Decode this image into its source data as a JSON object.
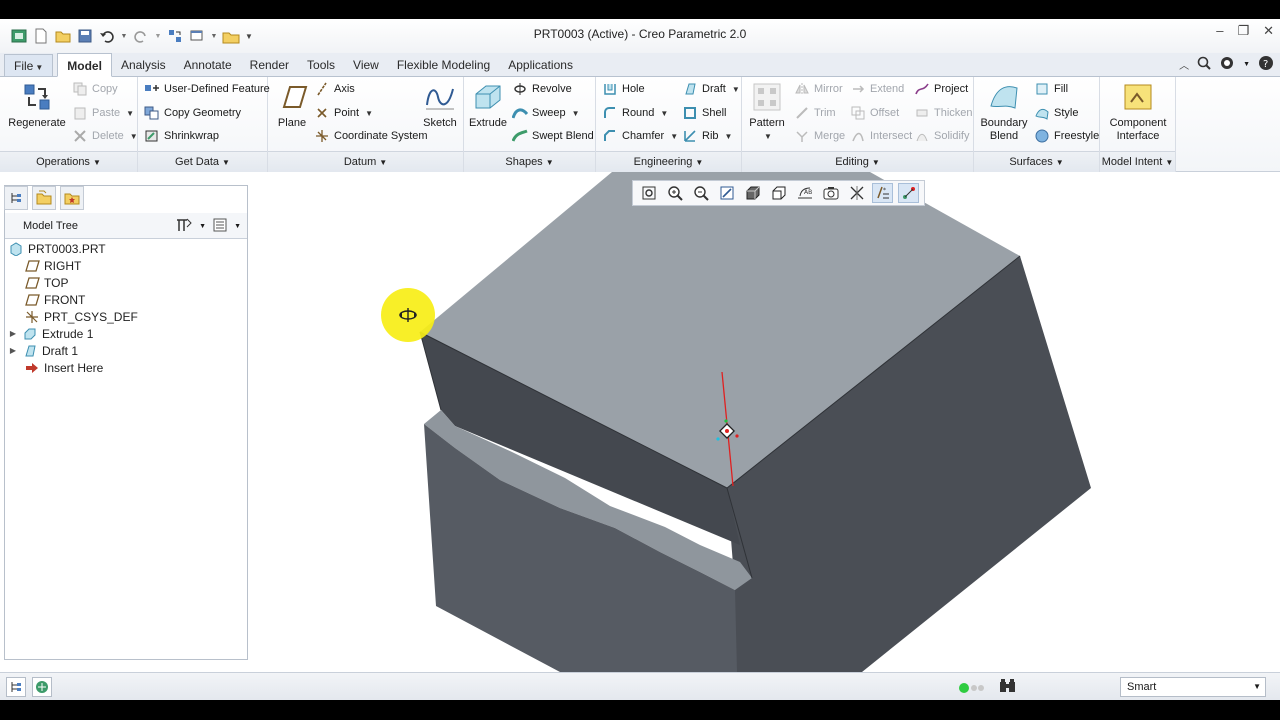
{
  "window": {
    "title": "PRT0003 (Active) - Creo Parametric 2.0",
    "controls": [
      "–",
      "❐",
      "✕"
    ]
  },
  "tabs": [
    "File",
    "Model",
    "Analysis",
    "Annotate",
    "Render",
    "Tools",
    "View",
    "Flexible Modeling",
    "Applications"
  ],
  "active_tab": "Model",
  "ribbon": {
    "operations": {
      "label": "Operations",
      "regenerate": "Regenerate",
      "copy": "Copy",
      "paste": "Paste",
      "delete": "Delete"
    },
    "get_data": {
      "label": "Get Data",
      "udf": "User-Defined Feature",
      "copy_geometry": "Copy Geometry",
      "shrinkwrap": "Shrinkwrap"
    },
    "datum": {
      "label": "Datum",
      "plane": "Plane",
      "axis": "Axis",
      "point": "Point",
      "csys": "Coordinate System",
      "sketch": "Sketch"
    },
    "shapes": {
      "label": "Shapes",
      "extrude": "Extrude",
      "revolve": "Revolve",
      "sweep": "Sweep",
      "swept_blend": "Swept Blend"
    },
    "engineering": {
      "label": "Engineering",
      "hole": "Hole",
      "round": "Round",
      "chamfer": "Chamfer",
      "draft": "Draft",
      "shell": "Shell",
      "rib": "Rib"
    },
    "editing": {
      "label": "Editing",
      "pattern": "Pattern",
      "mirror": "Mirror",
      "trim": "Trim",
      "merge": "Merge",
      "extend": "Extend",
      "offset": "Offset",
      "intersect": "Intersect",
      "project": "Project",
      "thicken": "Thicken",
      "solidify": "Solidify"
    },
    "surfaces": {
      "label": "Surfaces",
      "boundary_blend_1": "Boundary",
      "boundary_blend_2": "Blend",
      "fill": "Fill",
      "style": "Style",
      "freestyle": "Freestyle"
    },
    "model_intent": {
      "label": "Model Intent",
      "component_interface_1": "Component",
      "component_interface_2": "Interface"
    }
  },
  "model_tree": {
    "header": "Model Tree",
    "items": [
      {
        "label": "PRT0003.PRT",
        "icon": "part-icon"
      },
      {
        "label": "RIGHT",
        "icon": "datum-plane-icon"
      },
      {
        "label": "TOP",
        "icon": "datum-plane-icon"
      },
      {
        "label": "FRONT",
        "icon": "datum-plane-icon"
      },
      {
        "label": "PRT_CSYS_DEF",
        "icon": "csys-icon"
      },
      {
        "label": "Extrude 1",
        "icon": "extrude-icon"
      },
      {
        "label": "Draft 1",
        "icon": "draft-icon"
      },
      {
        "label": "Insert Here",
        "icon": "insert-arrow-icon"
      }
    ]
  },
  "status": {
    "filter": "Smart"
  },
  "colors": {
    "top_face": "#9aa1a8",
    "side_dark": "#4a4e55",
    "side_mid": "#585d65",
    "draft_face": "#8f969d",
    "highlight": "#f7ee16"
  }
}
